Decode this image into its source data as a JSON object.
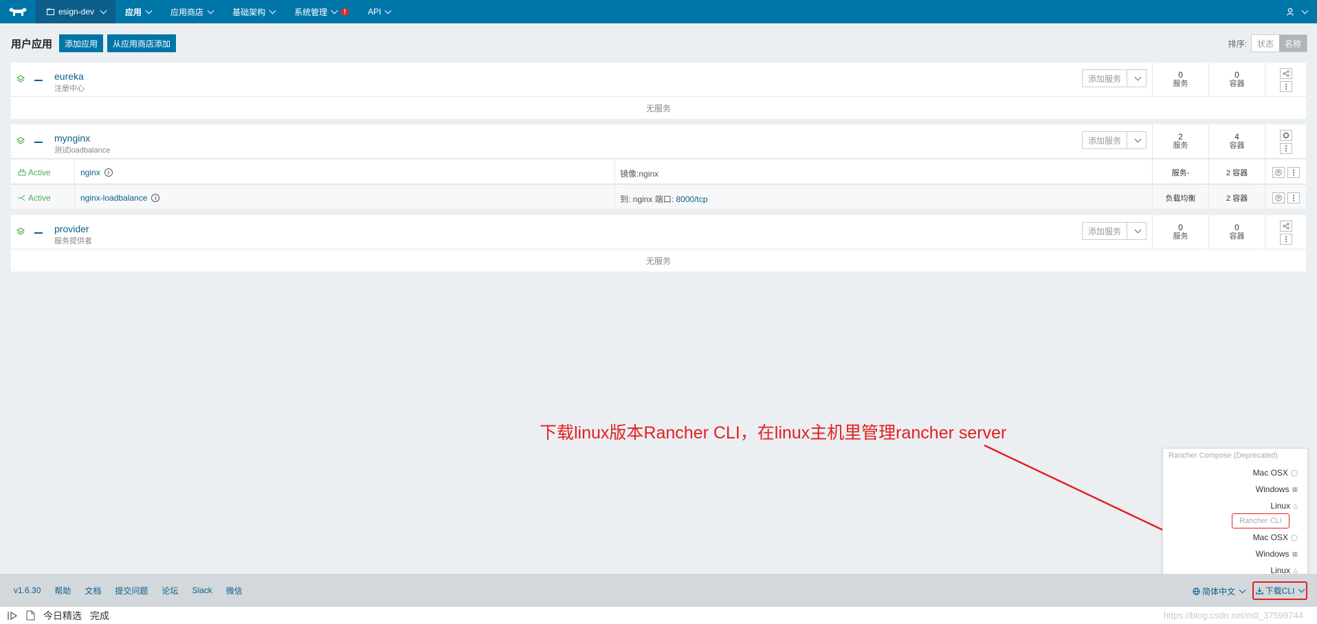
{
  "topbar": {
    "env_name": "esign-dev",
    "nav": [
      {
        "label": "应用",
        "active": true
      },
      {
        "label": "应用商店"
      },
      {
        "label": "基础架构"
      },
      {
        "label": "系统管理",
        "alert": "!"
      },
      {
        "label": "API"
      }
    ]
  },
  "header": {
    "title": "用户应用",
    "add_stack": "添加应用",
    "add_from_catalog": "从应用商店添加",
    "sort_label": "排序:",
    "sort_state": "状态",
    "sort_name": "名称"
  },
  "stacks": [
    {
      "name": "eureka",
      "description": "注册中心",
      "add_service": "添加服务",
      "services_count": "0",
      "services_label": "服务",
      "containers_count": "0",
      "containers_label": "容器",
      "empty_text": "无服务"
    },
    {
      "name": "mynginx",
      "description": "测试loadbalance",
      "add_service": "添加服务",
      "services_count": "2",
      "services_label": "服务",
      "containers_count": "4",
      "containers_label": "容器",
      "services": [
        {
          "state": "Active",
          "name": "nginx",
          "detail_prefix": "镜像:",
          "detail_value": "nginx",
          "kind": "服务-",
          "containers": "2 容器"
        },
        {
          "state": "Active",
          "name": "nginx-loadbalance",
          "detail_prefix": "到: nginx  端口:",
          "detail_value": "8000/tcp",
          "kind": "负载均衡",
          "containers": "2 容器"
        }
      ]
    },
    {
      "name": "provider",
      "description": "服务提供者",
      "add_service": "添加服务",
      "services_count": "0",
      "services_label": "服务",
      "containers_count": "0",
      "containers_label": "容器",
      "empty_text": "无服务"
    }
  ],
  "annotation": "下载linux版本Rancher CLI，在linux主机里管理rancher server",
  "cli_menu": {
    "compose_header": "Rancher Compose (Deprecated)",
    "compose_items": [
      "Mac OSX",
      "Windows",
      "Linux"
    ],
    "cli_header": "Rancher CLI",
    "cli_items": [
      "Mac OSX",
      "Windows",
      "Linux"
    ]
  },
  "footer": {
    "version": "v1.6.30",
    "links": [
      "帮助",
      "文档",
      "提交问题",
      "论坛",
      "Slack",
      "微信"
    ],
    "language": "简体中文",
    "download_cli": "下载CLI"
  },
  "statusbar": {
    "tab_label": "今日精选",
    "status": "完成",
    "watermark": "https://blog.csdn.net/m0_37599744"
  },
  "colors": {
    "topbar": "#0075a8",
    "accent": "#0b5f8a",
    "active": "#4caf50",
    "annotation": "#e02020"
  }
}
